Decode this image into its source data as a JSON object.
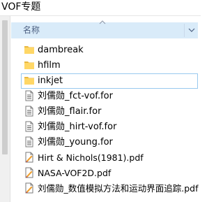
{
  "window": {
    "title": "VOF专题"
  },
  "column_header": {
    "name_label": "名称"
  },
  "items": [
    {
      "name": "dambreak",
      "type": "folder",
      "selected": false
    },
    {
      "name": "hfilm",
      "type": "folder",
      "selected": false
    },
    {
      "name": "inkjet",
      "type": "folder",
      "selected": true
    },
    {
      "name": "刘儒勋_fct-vof.for",
      "type": "text-file",
      "selected": false
    },
    {
      "name": "刘儒勋_flair.for",
      "type": "text-file",
      "selected": false
    },
    {
      "name": "刘儒勋_hirt-vof.for",
      "type": "text-file",
      "selected": false
    },
    {
      "name": "刘儒勋_young.for",
      "type": "text-file",
      "selected": false
    },
    {
      "name": "Hirt & Nichols(1981).pdf",
      "type": "pdf-file",
      "selected": false
    },
    {
      "name": "NASA-VOF2D.pdf",
      "type": "pdf-file",
      "selected": false
    },
    {
      "name": "刘儒勋_数值模拟方法和运动界面追踪.pdf",
      "type": "pdf-file",
      "selected": false
    }
  ],
  "colors": {
    "folder": "#ffd766",
    "folder_dark": "#e8b73f",
    "header_bg": "#d9ebf9",
    "header_text": "#4d6082",
    "selection_border": "#99c9ef",
    "pdf_red": "#d0312d",
    "pdf_orange": "#f0a030"
  }
}
